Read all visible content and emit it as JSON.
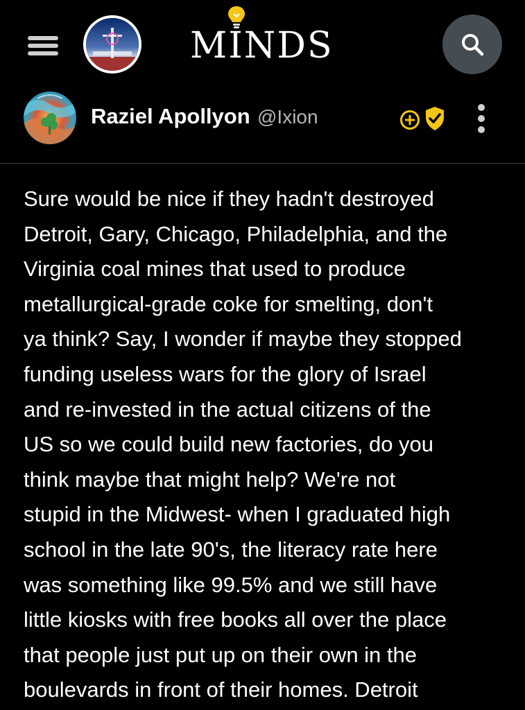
{
  "header": {
    "menu_icon": "hamburger-menu-icon",
    "user_avatar_icon": "user-avatar",
    "logo_text": "MINDS",
    "logo_icon": "lightbulb-icon",
    "search_icon": "search-icon"
  },
  "post": {
    "author_name": "Raziel Apollyon",
    "author_handle": "@Ixion",
    "badges": [
      "plus-badge-icon",
      "verified-shield-icon"
    ],
    "more_icon": "vertical-dots-icon",
    "body": "Sure would be nice if they hadn't destroyed\nDetroit, Gary, Chicago,  Philadelphia, and the\nVirginia coal mines that used to produce\nmetallurgical-grade coke for smelting, don't\nya think?  Say, I wonder if maybe they stopped\nfunding useless wars for the glory of Israel\nand re-invested in the actual citizens of the\nUS so we could build new factories, do you\nthink maybe that might help?  We're not\nstupid in the Midwest- when I graduated high\nschool in the late 90's, the literacy rate here\nwas something like 99.5% and we still have\nlittle kiosks with free books all over the place\nthat people just put up on their own in the\nboulevards in front of their homes.  Detroit"
  },
  "colors": {
    "background": "#000000",
    "text": "#ffffff",
    "handle": "#b6b6b6",
    "badge_gold": "#f5c518",
    "search_button": "#454d52",
    "icon_gray": "#cfcfcf"
  }
}
